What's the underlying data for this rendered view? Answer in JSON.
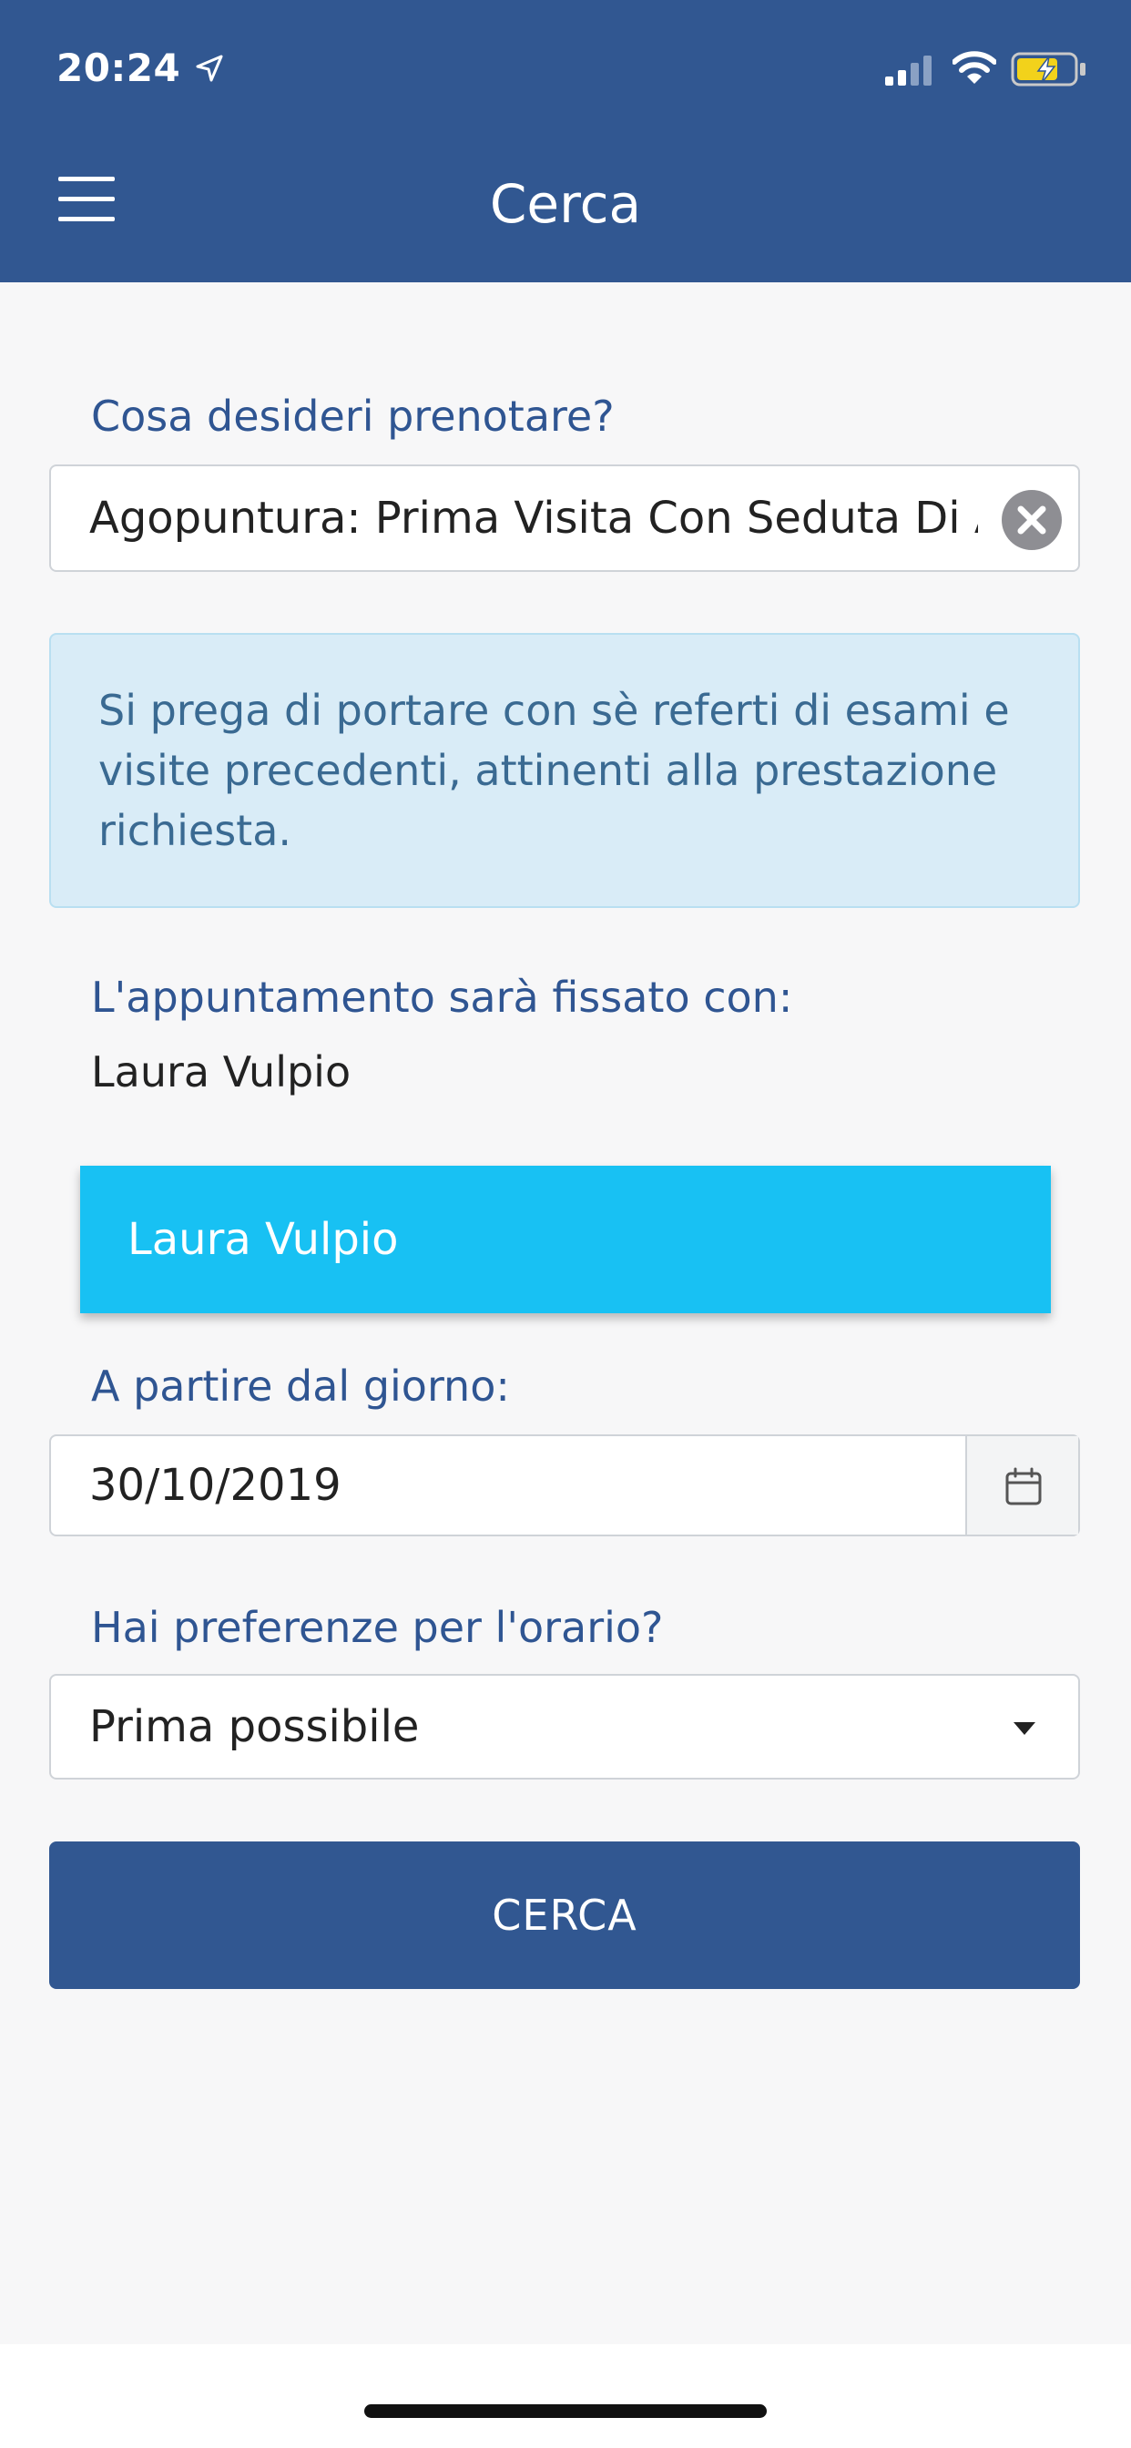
{
  "status_bar": {
    "time": "20:24"
  },
  "header": {
    "title": "Cerca"
  },
  "form": {
    "service_label": "Cosa desideri prenotare?",
    "service_value": "Agopuntura: Prima Visita Con Seduta Di A",
    "info_message": "Si prega di portare con sè referti di esami e visite precedenti, attinenti alla prestazione richiesta.",
    "doctor_label": "L'appuntamento sarà fissato con:",
    "doctor_name": "Laura Vulpio",
    "doctor_option": "Laura Vulpio",
    "date_label": "A partire dal giorno:",
    "date_value": "30/10/2019",
    "time_pref_label": "Hai preferenze per l'orario?",
    "time_pref_value": "Prima possibile",
    "search_button": "CERCA"
  },
  "colors": {
    "brand": "#315791",
    "accent": "#18c1f3",
    "info_bg": "#d9ecf7"
  }
}
